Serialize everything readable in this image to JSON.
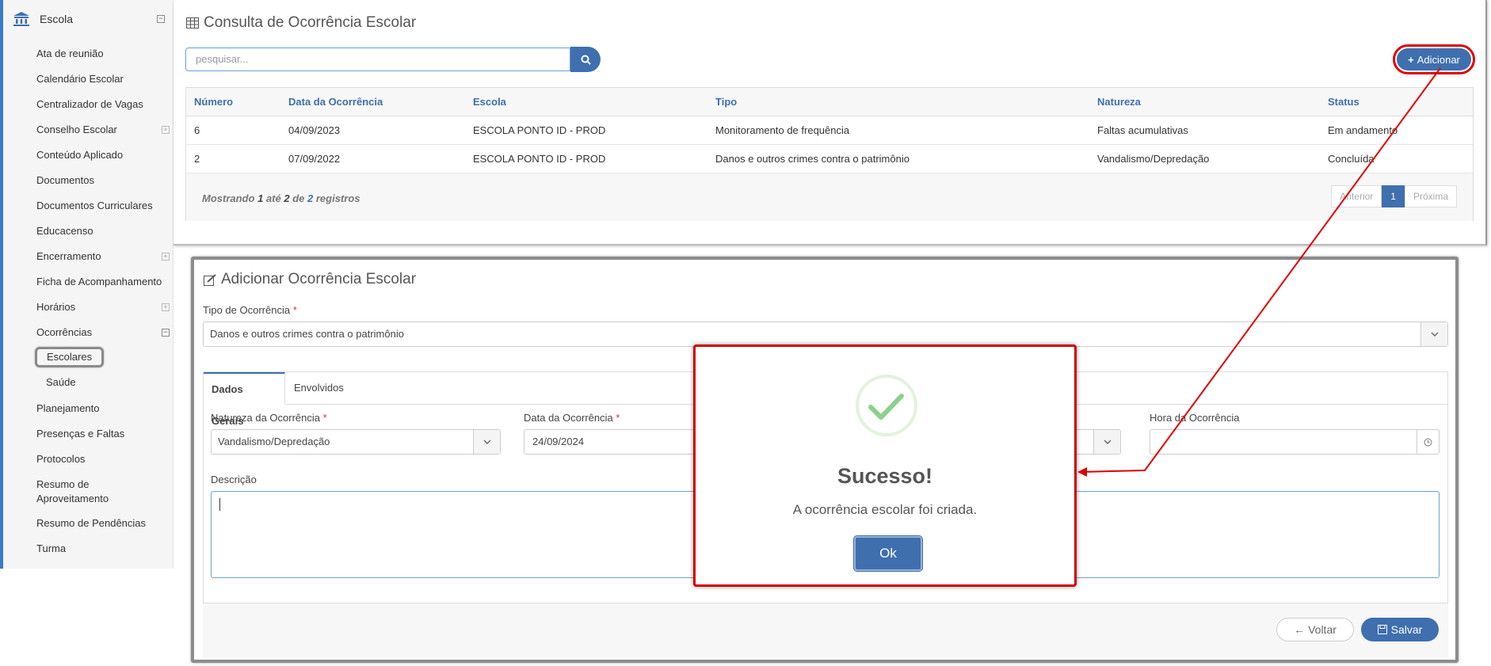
{
  "sidebar": {
    "title": "Escola",
    "items": [
      {
        "label": "Ata de reunião"
      },
      {
        "label": "Calendário Escolar"
      },
      {
        "label": "Centralizador de Vagas"
      },
      {
        "label": "Conselho Escolar"
      },
      {
        "label": "Conteúdo Aplicado"
      },
      {
        "label": "Documentos"
      },
      {
        "label": "Documentos Curriculares"
      },
      {
        "label": "Educacenso"
      },
      {
        "label": "Encerramento"
      },
      {
        "label": "Ficha de Acompanhamento"
      },
      {
        "label": "Horários"
      },
      {
        "label": "Ocorrências"
      },
      {
        "label": "Planejamento"
      },
      {
        "label": "Presenças e Faltas"
      },
      {
        "label": "Protocolos"
      },
      {
        "label": "Resumo de Aproveitamento"
      },
      {
        "label": "Resumo de Pendências"
      },
      {
        "label": "Turma"
      }
    ],
    "ocorrencias_sub": [
      {
        "label": "Escolares"
      },
      {
        "label": "Saúde"
      }
    ]
  },
  "consulta": {
    "title": "Consulta de Ocorrência Escolar",
    "search_placeholder": "pesquisar...",
    "add_label": "Adicionar",
    "columns": [
      "Número",
      "Data da Ocorrência",
      "Escola",
      "Tipo",
      "Natureza",
      "Status"
    ],
    "rows": [
      [
        "6",
        "04/09/2023",
        "ESCOLA PONTO ID - PROD",
        "Monitoramento de frequência",
        "Faltas acumulativas",
        "Em andamento"
      ],
      [
        "2",
        "07/09/2022",
        "ESCOLA PONTO ID - PROD",
        "Danos e outros crimes contra o patrimônio",
        "Vandalismo/Depredação",
        "Concluída"
      ]
    ],
    "footer": {
      "prefix": "Mostrando",
      "from": "1",
      "until_word": "até",
      "to": "2",
      "of_word": "de",
      "total": "2",
      "suffix": "registros"
    },
    "pager": {
      "prev": "Anterior",
      "current": "1",
      "next": "Próxima"
    }
  },
  "adicionar": {
    "title": "Adicionar Ocorrência Escolar",
    "tipo_label": "Tipo de Ocorrência",
    "tipo_value": "Danos e outros crimes contra o patrimônio",
    "tabs": [
      "Dados Gerais",
      "Envolvidos"
    ],
    "natureza_label": "Natureza da Ocorrência",
    "natureza_value": "Vandalismo/Depredação",
    "data_label": "Data da Ocorrência",
    "data_value": "24/09/2024",
    "hora_label": "Hora da Ocorrência",
    "descricao_label": "Descrição",
    "voltar_label": "Voltar",
    "salvar_label": "Salvar",
    "required_mark": "*"
  },
  "modal": {
    "title": "Sucesso!",
    "message": "A ocorrência escolar foi criada.",
    "ok_label": "Ok"
  },
  "colors": {
    "primary": "#3f6fae",
    "highlight": "#e00000",
    "success": "#8cd08c"
  }
}
